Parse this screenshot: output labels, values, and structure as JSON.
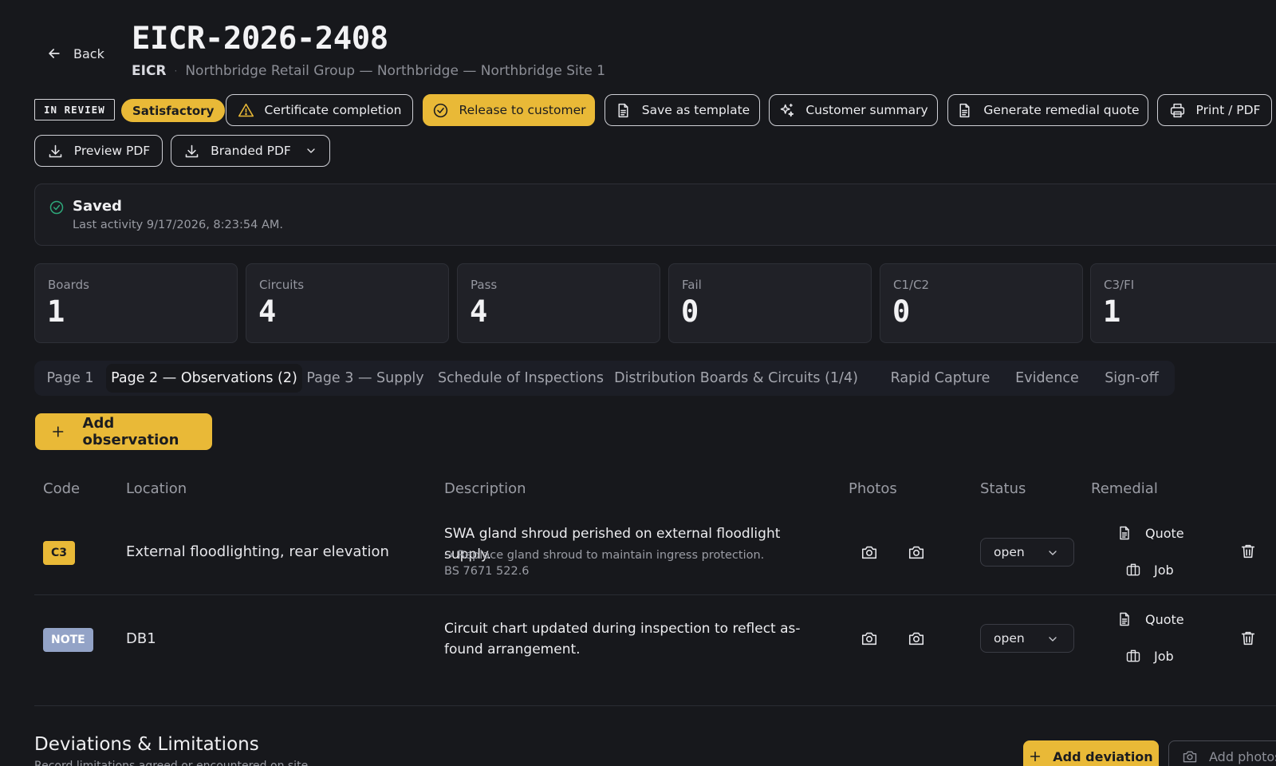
{
  "header": {
    "back_label": "Back",
    "title": "EICR-2026-2408",
    "kind": "EICR",
    "location": "Northbridge Retail Group — Northbridge — Northbridge Site 1"
  },
  "toolbar": {
    "status_badge": "IN REVIEW",
    "result_badge": "Satisfactory",
    "certificate_completion": "Certificate completion",
    "release_to_customer": "Release to customer",
    "save_as_template": "Save as template",
    "customer_summary": "Customer summary",
    "generate_remedial_quote": "Generate remedial quote",
    "print_pdf": "Print / PDF",
    "preview_pdf": "Preview PDF",
    "branded_pdf": "Branded PDF"
  },
  "saved": {
    "title": "Saved",
    "last_activity": "Last activity 9/17/2026, 8:23:54 AM."
  },
  "stats": [
    {
      "label": "Boards",
      "value": "1"
    },
    {
      "label": "Circuits",
      "value": "4"
    },
    {
      "label": "Pass",
      "value": "4"
    },
    {
      "label": "Fail",
      "value": "0"
    },
    {
      "label": "C1/C2",
      "value": "0"
    },
    {
      "label": "C3/FI",
      "value": "1"
    }
  ],
  "tabs": [
    {
      "label": "Page 1"
    },
    {
      "label": "Page 2 — Observations (2)",
      "active": true
    },
    {
      "label": "Page 3 — Supply"
    },
    {
      "label": "Schedule of Inspections"
    },
    {
      "label": "Distribution Boards & Circuits (1/4)"
    },
    {
      "label": "Rapid Capture"
    },
    {
      "label": "Evidence"
    },
    {
      "label": "Sign-off"
    }
  ],
  "observations": {
    "add_label": "Add observation",
    "columns": {
      "code": "Code",
      "location": "Location",
      "description": "Description",
      "photos": "Photos",
      "status": "Status",
      "remedial": "Remedial"
    },
    "rows": [
      {
        "code": "C3",
        "location": "External floodlighting, rear elevation",
        "description": "SWA gland shroud perished on external floodlight supply.",
        "remedy": "→ Replace gland shroud to maintain ingress protection.",
        "reference": "BS 7671 522.6",
        "status": "open",
        "quote_label": "Quote",
        "job_label": "Job"
      },
      {
        "code": "NOTE",
        "location": "DB1",
        "description": "Circuit chart updated during inspection to reflect as-found arrangement.",
        "status": "open",
        "quote_label": "Quote",
        "job_label": "Job"
      }
    ]
  },
  "deviations": {
    "title": "Deviations & Limitations",
    "subtitle": "Record limitations agreed or encountered on site.",
    "add_label": "Add deviation",
    "add_photos_label": "Add photos"
  },
  "colors": {
    "background": "#17181c",
    "accent": "#e9b937",
    "note_badge": "#93a3c7",
    "success": "#2ea77a"
  }
}
